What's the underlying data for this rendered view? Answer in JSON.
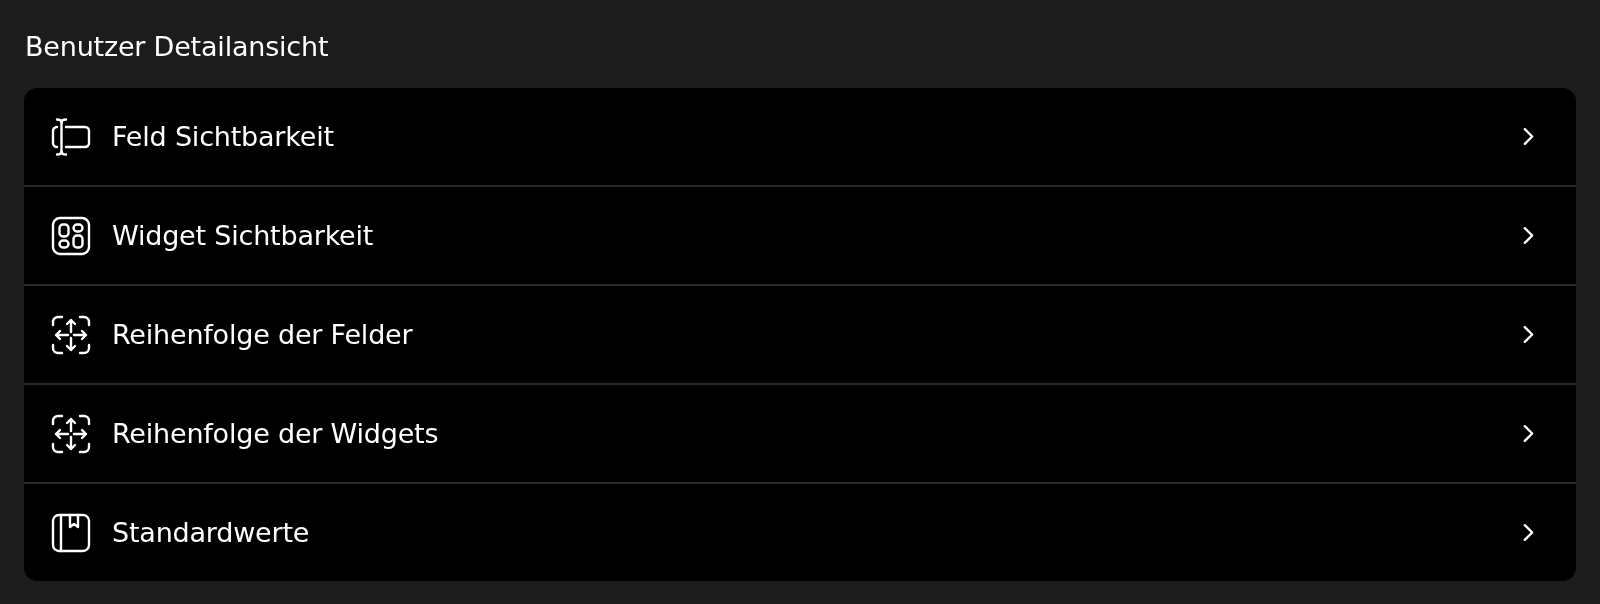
{
  "section": {
    "title": "Benutzer Detailansicht"
  },
  "items": [
    {
      "label": "Feld Sichtbarkeit",
      "kind": "field"
    },
    {
      "label": "Widget Sichtbarkeit",
      "kind": "widget"
    },
    {
      "label": "Reihenfolge der Felder",
      "kind": "reorder"
    },
    {
      "label": "Reihenfolge der Widgets",
      "kind": "reorder"
    },
    {
      "label": "Standardwerte",
      "kind": "defaults"
    }
  ]
}
